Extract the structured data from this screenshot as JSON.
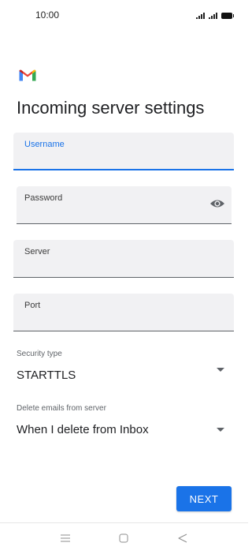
{
  "status_bar": {
    "time": "10:00",
    "icons": [
      "signal-icon",
      "signal-icon",
      "battery-icon"
    ]
  },
  "header": {
    "logo": "gmail-logo",
    "title": "Incoming server settings"
  },
  "fields": {
    "username": {
      "label": "Username",
      "value": "",
      "focused": true
    },
    "password": {
      "label": "Password",
      "value": "",
      "icon": "eye-icon"
    },
    "server": {
      "label": "Server",
      "value": ""
    },
    "port": {
      "label": "Port",
      "value": ""
    }
  },
  "security_type": {
    "label": "Security type",
    "value": "STARTTLS"
  },
  "delete_emails": {
    "label": "Delete emails from server",
    "value": "When I delete from Inbox"
  },
  "next_button": {
    "label": "NEXT"
  },
  "nav_bar": {
    "icons": [
      "menu-icon",
      "home-icon",
      "back-icon"
    ]
  },
  "colors": {
    "accent": "#1a73e8",
    "field_background": "#f1f1f3",
    "text_primary": "#202124",
    "text_secondary": "#5f6368"
  }
}
